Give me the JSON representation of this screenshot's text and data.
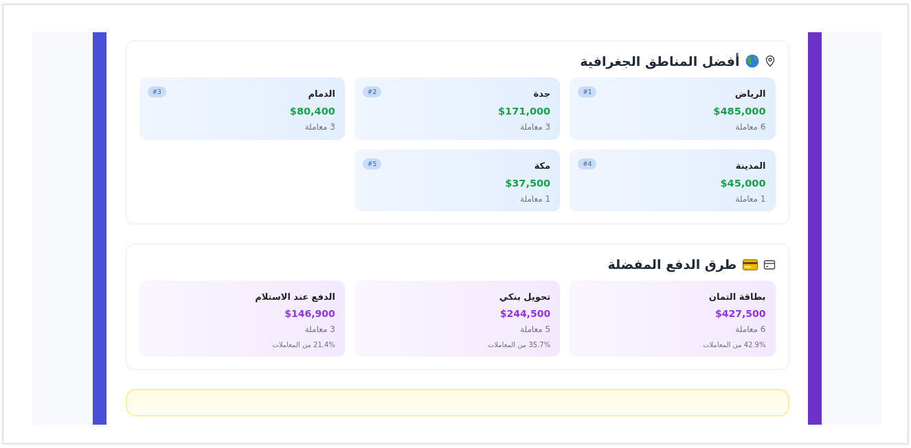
{
  "regions": {
    "title": "أفضل المناطق الجغرافية",
    "items": [
      {
        "name": "الرياض",
        "amount": "$485,000",
        "count": "6 معاملة",
        "rank": "#1"
      },
      {
        "name": "جدة",
        "amount": "$171,000",
        "count": "3 معاملة",
        "rank": "#2"
      },
      {
        "name": "الدمام",
        "amount": "$80,400",
        "count": "3 معاملة",
        "rank": "#3"
      },
      {
        "name": "المدينة",
        "amount": "$45,000",
        "count": "1 معاملة",
        "rank": "#4"
      },
      {
        "name": "مكة",
        "amount": "$37,500",
        "count": "1 معاملة",
        "rank": "#5"
      }
    ]
  },
  "payments": {
    "title": "طرق الدفع المفضلة",
    "items": [
      {
        "name": "بطاقة التمان",
        "amount": "$427,500",
        "count": "6 معاملة",
        "share": "42.9% من المعاملات"
      },
      {
        "name": "تحويل بنكي",
        "amount": "$244,500",
        "count": "5 معاملة",
        "share": "35.7% من المعاملات"
      },
      {
        "name": "الدفع عند الاستلام",
        "amount": "$146,900",
        "count": "3 معاملة",
        "share": "21.4% من المعاملات"
      }
    ]
  }
}
